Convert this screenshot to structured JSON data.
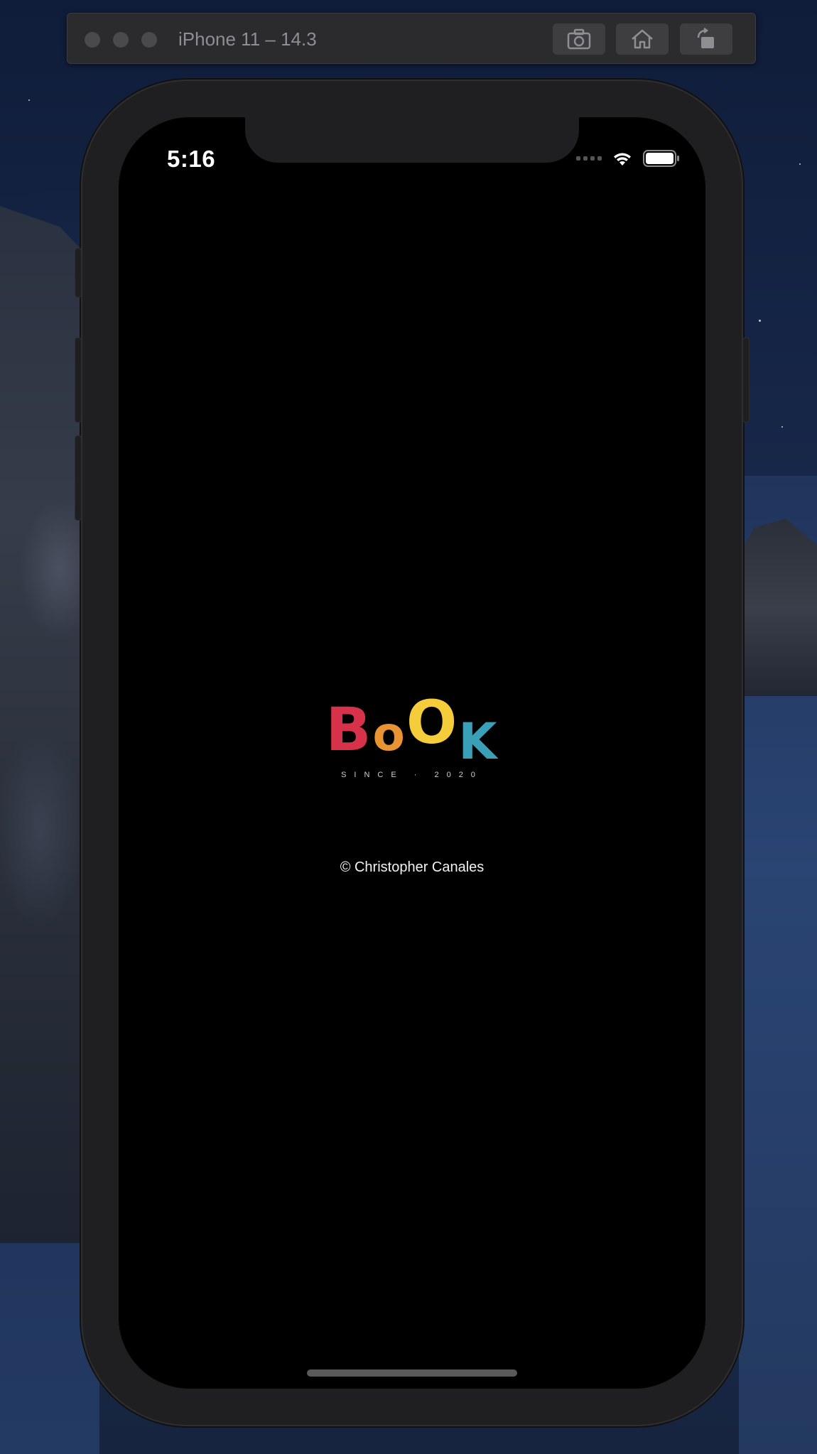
{
  "simulator": {
    "title": "iPhone 11 – 14.3",
    "buttons": [
      {
        "icon": "screenshot-icon"
      },
      {
        "icon": "home-icon"
      },
      {
        "icon": "rotate-icon"
      }
    ]
  },
  "status_bar": {
    "time": "5:16",
    "icons": [
      "cellular-signal-icon",
      "wifi-icon",
      "battery-icon"
    ]
  },
  "splash": {
    "logo_letters": [
      "B",
      "o",
      "O",
      "K"
    ],
    "logo_colors": [
      "#d6334a",
      "#e89432",
      "#f5cd3a",
      "#3aa0b8"
    ],
    "tagline": "SINCE · 2020",
    "copyright": "© Christopher Canales"
  }
}
